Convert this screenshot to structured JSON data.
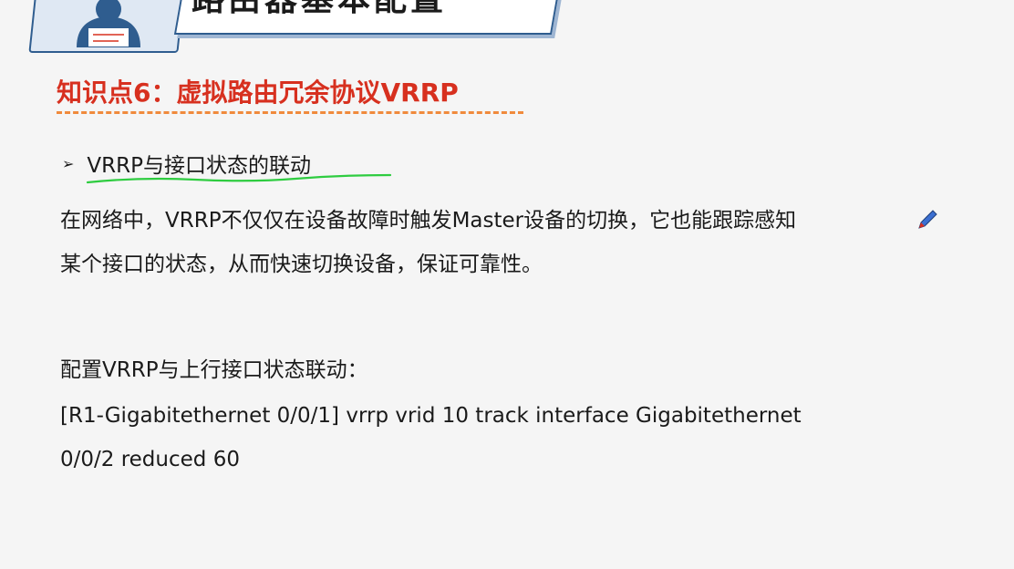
{
  "header": {
    "title": "路由器基本配置"
  },
  "section": {
    "knowledge_title": "知识点6：虚拟路由冗余协议VRRP"
  },
  "bullet": {
    "marker": "➢",
    "text": "VRRP与接口状态的联动"
  },
  "body": {
    "line1": "在网络中，VRRP不仅仅在设备故障时触发Master设备的切换，它也能跟踪感知",
    "line2": "某个接口的状态，从而快速切换设备，保证可靠性。",
    "config_label": "配置VRRP与上行接口状态联动：",
    "command_line1": "[R1-Gigabitethernet 0/0/1] vrrp vrid 10 track interface Gigabitethernet",
    "command_line2": "0/0/2 reduced 60"
  },
  "colors": {
    "accent_red": "#d7301f",
    "dash_orange": "#f08a3c",
    "highlight_green": "#2ecc40",
    "banner_blue": "#2f5d8f"
  }
}
